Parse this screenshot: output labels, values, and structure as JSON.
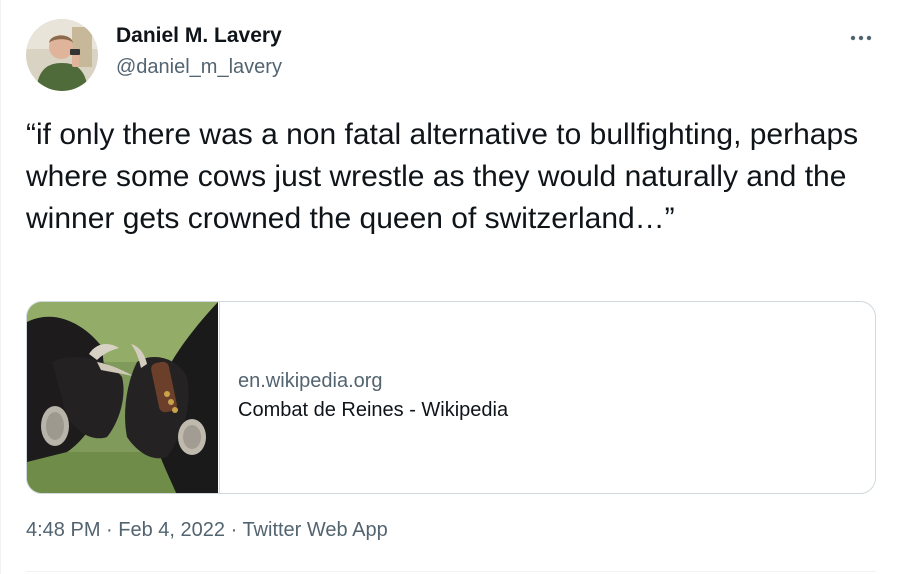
{
  "author": {
    "display_name": "Daniel M. Lavery",
    "handle": "@daniel_m_lavery"
  },
  "tweet": {
    "text": "“if only there was a non fatal alternative to bullfighting, perhaps where some cows just wrestle as they would naturally and the winner gets crowned the queen of switzerland…”"
  },
  "card": {
    "domain": "en.wikipedia.org",
    "title": "Combat de Reines - Wikipedia",
    "image_icon": "cows-wrestling-photo"
  },
  "meta": {
    "time": "4:48 PM",
    "sep1": " · ",
    "date": "Feb 4, 2022",
    "sep2": " · ",
    "source": "Twitter Web App"
  },
  "icons": {
    "more": "more-horizontal-icon",
    "avatar": "avatar-photo"
  },
  "colors": {
    "text_primary": "#0f1419",
    "text_secondary": "#536471",
    "border": "#cfd9de"
  }
}
